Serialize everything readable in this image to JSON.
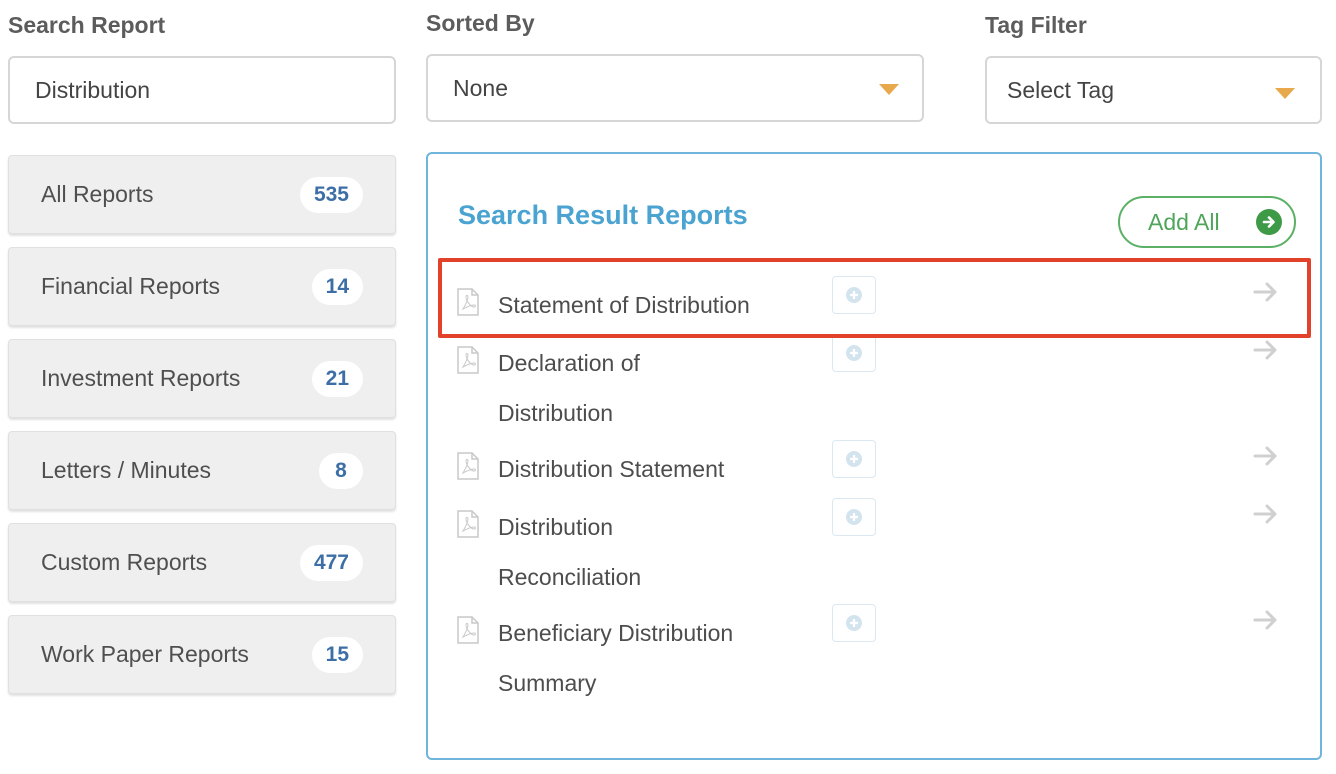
{
  "search": {
    "label": "Search Report",
    "value": "Distribution"
  },
  "sort": {
    "label": "Sorted By",
    "value": "None"
  },
  "tag": {
    "label": "Tag Filter",
    "value": "Select Tag"
  },
  "categories": [
    {
      "name": "All Reports",
      "count": "535"
    },
    {
      "name": "Financial Reports",
      "count": "14"
    },
    {
      "name": "Investment Reports",
      "count": "21"
    },
    {
      "name": "Letters / Minutes",
      "count": "8"
    },
    {
      "name": "Custom Reports",
      "count": "477"
    },
    {
      "name": "Work Paper Reports",
      "count": "15"
    }
  ],
  "results": {
    "title": "Search Result Reports",
    "add_all_label": "Add All",
    "items": [
      {
        "title": "Statement of Distribution"
      },
      {
        "title": "Declaration of Distribution"
      },
      {
        "title": "Distribution Statement"
      },
      {
        "title": "Distribution Reconciliation"
      },
      {
        "title": "Beneficiary Distribution Summary"
      }
    ]
  },
  "colors": {
    "accent_blue": "#4aa3d1",
    "add_green": "#4fa55a",
    "caret_orange": "#e8a94c",
    "highlight_red": "#e2412a"
  }
}
